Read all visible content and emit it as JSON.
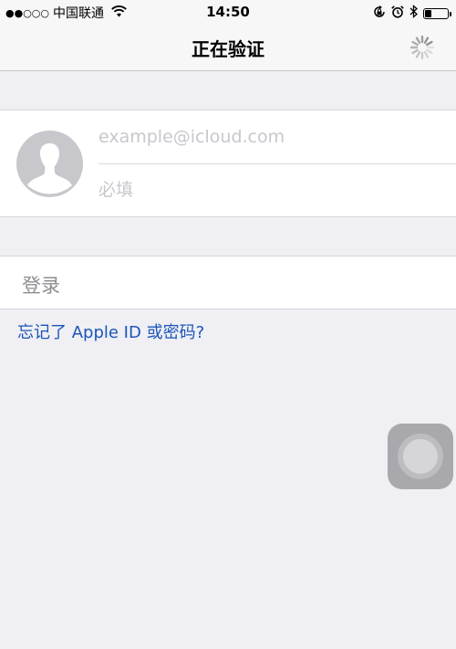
{
  "status_bar": {
    "signal": "●●○○○",
    "carrier": "中国联通",
    "time": "14:50",
    "battery_level": 0.25,
    "icons": [
      "wifi-icon",
      "orientation-lock-icon",
      "alarm-icon",
      "bluetooth-icon",
      "battery-icon"
    ]
  },
  "nav": {
    "title": "正在验证",
    "activity": "spinner-icon"
  },
  "form": {
    "avatar_icon": "person-silhouette-icon",
    "email_placeholder": "example@icloud.com",
    "password_placeholder": "必填"
  },
  "login_label": "登录",
  "forgot_link": "忘记了 Apple ID 或密码?",
  "assistive_touch_icon": "assistive-touch-icon",
  "colors": {
    "background": "#efeff4",
    "link": "#1c56b8",
    "placeholder": "#c7c7cd",
    "login_text": "#8e8e93"
  }
}
